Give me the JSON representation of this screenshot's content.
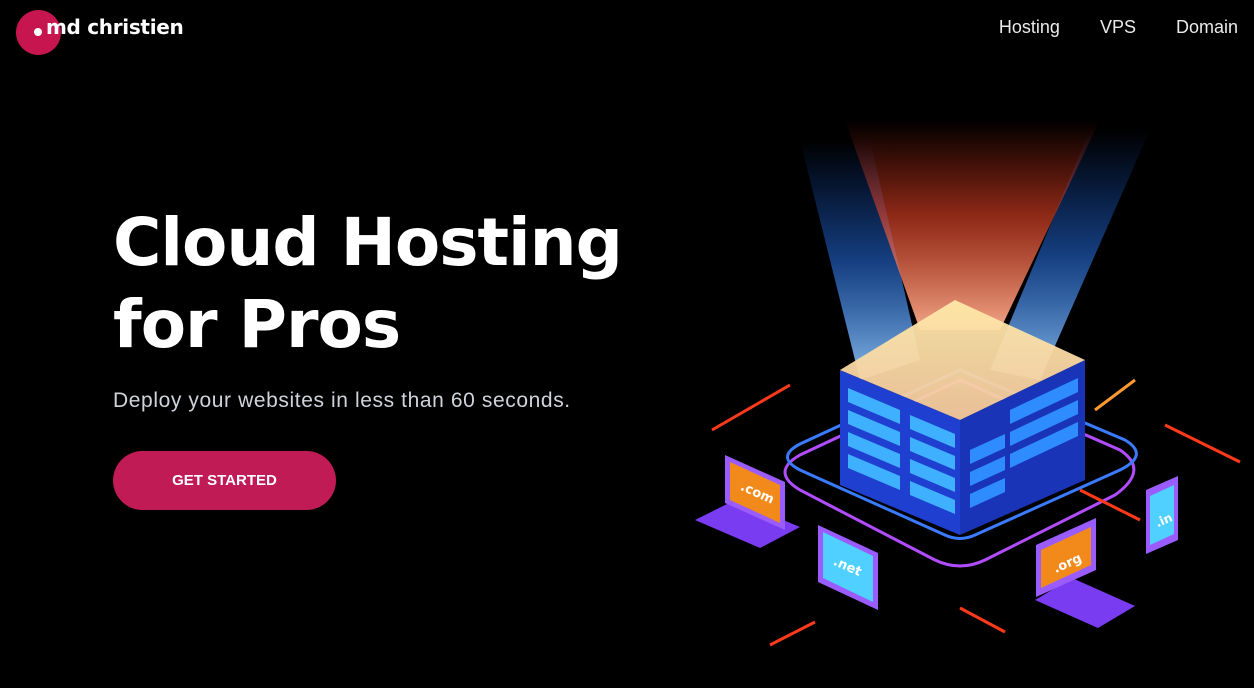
{
  "brand": {
    "name": "md christien"
  },
  "nav": [
    {
      "label": "Hosting"
    },
    {
      "label": "VPS"
    },
    {
      "label": "Domain"
    }
  ],
  "hero": {
    "title_line1": "Cloud Hosting",
    "title_line2": "for Pros",
    "subtitle": "Deploy your websites in less than 60 seconds.",
    "cta_label": "GET STARTED"
  },
  "illustration": {
    "domains": [
      ".com",
      ".net",
      ".org",
      ".in"
    ]
  },
  "colors": {
    "accent": "#c01b54",
    "background": "#000000",
    "server_blue": "#1e3fd8",
    "device_purple": "#7a3cf0",
    "screen_orange": "#f28a1b"
  }
}
